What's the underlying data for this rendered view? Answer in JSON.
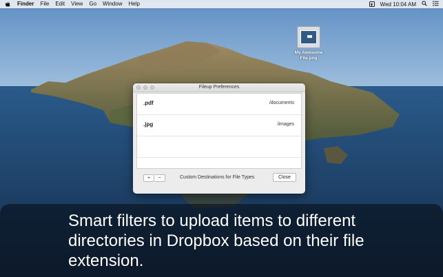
{
  "menubar": {
    "items": [
      "Finder",
      "File",
      "Edit",
      "View",
      "Go",
      "Window",
      "Help"
    ],
    "clock": "Wed 10:04 AM",
    "status_icon": "upload-status-icon"
  },
  "desktop_file": {
    "name": "My Awesome File.png"
  },
  "window": {
    "title": "Fileup Preferences",
    "rows": [
      {
        "extension": ".pdf",
        "destination": "/documents"
      },
      {
        "extension": ".jpg",
        "destination": "/images"
      }
    ],
    "add_label": "+",
    "remove_label": "−",
    "footer_caption": "Custom Destinations for File Types",
    "close_label": "Close"
  },
  "caption": {
    "text": "Smart filters to upload items to different directories in Dropbox based on their file extension."
  },
  "colors": {
    "sky_top": "#4d7bb0",
    "sea": "#1f3f66",
    "island": "#7a6a4e",
    "overlay": "#0b1422"
  }
}
